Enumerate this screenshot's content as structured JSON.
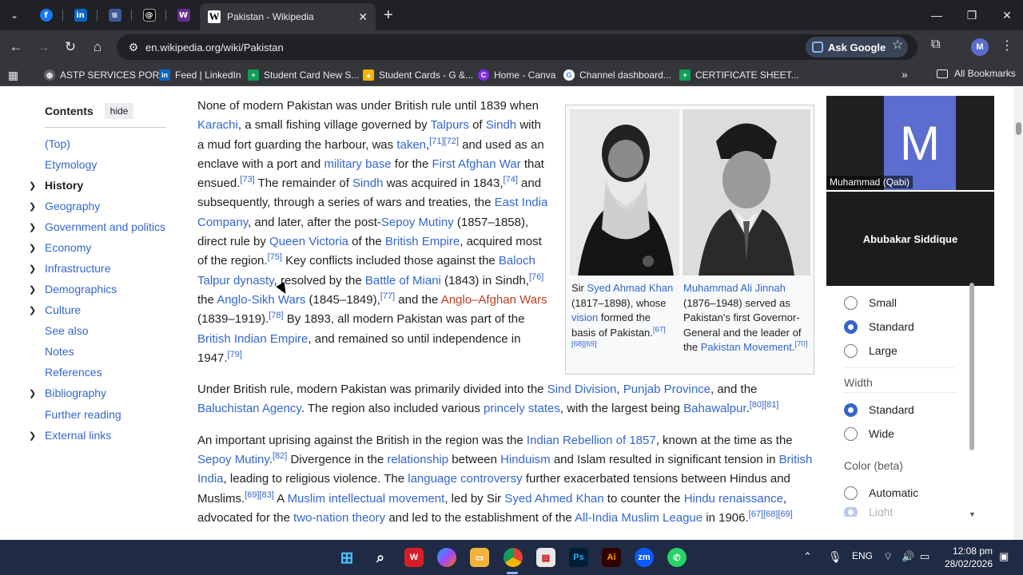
{
  "browser": {
    "active_tab_title": "Pakistan - Wikipedia",
    "url": "en.wikipedia.org/wiki/Pakistan",
    "ask_google": "Ask Google",
    "profile_initial": "M",
    "bookmarks": [
      {
        "label": "ASTP SERVICES POR...",
        "color": "#5f6368",
        "icon": "globe-icon"
      },
      {
        "label": "Feed | LinkedIn",
        "color": "#0a66c2",
        "icon": "linkedin-icon"
      },
      {
        "label": "Student Card New S...",
        "color": "#0f9d58",
        "icon": "sheets-icon"
      },
      {
        "label": "Student Cards - G &...",
        "color": "#f4b400",
        "icon": "drive-icon"
      },
      {
        "label": "Home - Canva",
        "color": "#7d2ae8",
        "icon": "canva-icon"
      },
      {
        "label": "Channel dashboard...",
        "color": "#5f6368",
        "icon": "google-icon"
      },
      {
        "label": "CERTIFICATE SHEET...",
        "color": "#0f9d58",
        "icon": "sheets-icon"
      }
    ],
    "all_bookmarks": "All Bookmarks"
  },
  "toc": {
    "title": "Contents",
    "hide": "hide",
    "items": [
      {
        "label": "(Top)",
        "expandable": false,
        "bold": false
      },
      {
        "label": "Etymology",
        "expandable": false,
        "bold": false
      },
      {
        "label": "History",
        "expandable": true,
        "bold": true
      },
      {
        "label": "Geography",
        "expandable": true,
        "bold": false
      },
      {
        "label": "Government and politics",
        "expandable": true,
        "bold": false
      },
      {
        "label": "Economy",
        "expandable": true,
        "bold": false
      },
      {
        "label": "Infrastructure",
        "expandable": true,
        "bold": false
      },
      {
        "label": "Demographics",
        "expandable": true,
        "bold": false
      },
      {
        "label": "Culture",
        "expandable": true,
        "bold": false
      },
      {
        "label": "See also",
        "expandable": false,
        "bold": false
      },
      {
        "label": "Notes",
        "expandable": false,
        "bold": false
      },
      {
        "label": "References",
        "expandable": false,
        "bold": false
      },
      {
        "label": "Bibliography",
        "expandable": true,
        "bold": false
      },
      {
        "label": "Further reading",
        "expandable": false,
        "bold": false
      },
      {
        "label": "External links",
        "expandable": true,
        "bold": false
      }
    ]
  },
  "article": {
    "paragraphs": [
      [
        {
          "t": "None of modern Pakistan was under British rule until 1839 when "
        },
        {
          "t": "Karachi",
          "link": true
        },
        {
          "t": ", a small fishing village governed by "
        },
        {
          "t": "Talpurs",
          "link": true
        },
        {
          "t": " of "
        },
        {
          "t": "Sindh",
          "link": true
        },
        {
          "t": " with a mud fort guarding the harbour, was "
        },
        {
          "t": "taken",
          "link": true
        },
        {
          "t": ",",
          "sup_after": "[71][72]"
        },
        {
          "t": " and used as an enclave with a port and "
        },
        {
          "t": "military base",
          "link": true
        },
        {
          "t": " for the "
        },
        {
          "t": "First Afghan War",
          "link": true
        },
        {
          "t": " that ensued."
        },
        {
          "t": "",
          "sup_after": "[73]"
        },
        {
          "t": " The remainder of "
        },
        {
          "t": "Sindh",
          "link": true
        },
        {
          "t": " was acquired in 1843,"
        },
        {
          "t": "",
          "sup_after": "[74]"
        },
        {
          "t": " and subsequently, through a series of wars and treaties, the "
        },
        {
          "t": "East India Company",
          "link": true
        },
        {
          "t": ", and later, after the post-"
        },
        {
          "t": "Sepoy Mutiny",
          "link": true
        },
        {
          "t": " (1857–1858), direct rule by "
        },
        {
          "t": "Queen Victoria",
          "link": true
        },
        {
          "t": " of the "
        },
        {
          "t": "British Empire",
          "link": true
        },
        {
          "t": ", acquired most of the region."
        },
        {
          "t": "",
          "sup_after": "[75]"
        },
        {
          "t": " Key conflicts included those against the "
        },
        {
          "t": "Baloch Talpur dynasty",
          "link": true
        },
        {
          "t": ", resolved by the "
        },
        {
          "t": "Battle of Miani",
          "link": true
        },
        {
          "t": " (1843) in Sindh,"
        },
        {
          "t": "",
          "sup_after": "[76]"
        },
        {
          "t": " the "
        },
        {
          "t": "Anglo-Sikh Wars",
          "link": true
        },
        {
          "t": " (1845–1849),"
        },
        {
          "t": "",
          "sup_after": "[77]"
        },
        {
          "t": " and the "
        },
        {
          "t": "Anglo–Afghan Wars",
          "link": "red"
        },
        {
          "t": " (1839–1919)."
        },
        {
          "t": "",
          "sup_after": "[78]"
        },
        {
          "t": " By 1893, all modern Pakistan was part of the "
        },
        {
          "t": "British Indian Empire",
          "link": true
        },
        {
          "t": ", and remained so until independence in 1947."
        },
        {
          "t": "",
          "sup_after": "[79]"
        }
      ],
      [
        {
          "t": "Under British rule, modern Pakistan was primarily divided into the "
        },
        {
          "t": "Sind Division",
          "link": true
        },
        {
          "t": ", "
        },
        {
          "t": "Punjab Province",
          "link": true
        },
        {
          "t": ", and the "
        },
        {
          "t": "Baluchistan Agency",
          "link": true
        },
        {
          "t": ". The region also included various "
        },
        {
          "t": "princely states",
          "link": true
        },
        {
          "t": ", with the largest being "
        },
        {
          "t": "Bahawalpur",
          "link": true
        },
        {
          "t": ".",
          "sup_after": "[80][81]"
        }
      ],
      [
        {
          "t": "An important uprising against the British in the region was the "
        },
        {
          "t": "Indian Rebellion of 1857",
          "link": true
        },
        {
          "t": ", known at the time as the "
        },
        {
          "t": "Sepoy Mutiny",
          "link": true
        },
        {
          "t": ".",
          "sup_after": "[82]"
        },
        {
          "t": " Divergence in the "
        },
        {
          "t": "relationship",
          "link": true
        },
        {
          "t": " between "
        },
        {
          "t": "Hinduism",
          "link": true
        },
        {
          "t": " and Islam resulted in significant tension in "
        },
        {
          "t": "British India",
          "link": true
        },
        {
          "t": ", leading to religious violence. The "
        },
        {
          "t": "language controversy",
          "link": true
        },
        {
          "t": " further exacerbated tensions between Hindus and Muslims."
        },
        {
          "t": "",
          "sup_after": "[69][83]"
        },
        {
          "t": " A "
        },
        {
          "t": "Muslim intellectual movement",
          "link": true
        },
        {
          "t": ", led by Sir "
        },
        {
          "t": "Syed Ahmed Khan",
          "link": true
        },
        {
          "t": " to counter the "
        },
        {
          "t": "Hindu renaissance",
          "link": true
        },
        {
          "t": ", advocated for the "
        },
        {
          "t": "two-nation theory",
          "link": true
        },
        {
          "t": " and led to the establishment of the "
        },
        {
          "t": "All-India Muslim League",
          "link": true
        },
        {
          "t": " in 1906."
        },
        {
          "t": "",
          "sup_after": "[67][68][69]"
        }
      ]
    ]
  },
  "figure": {
    "left_caption": [
      {
        "t": "Sir "
      },
      {
        "t": "Syed Ahmad Khan",
        "link": true
      },
      {
        "t": " (1817–1898), whose "
      },
      {
        "t": "vision",
        "link": true
      },
      {
        "t": " formed the basis of Pakistan."
      },
      {
        "t": "",
        "sup_after": "[67][68][69]"
      }
    ],
    "right_caption": [
      {
        "t": "Muhammad Ali Jinnah",
        "link": true
      },
      {
        "t": " (1876–1948) served as Pakistan's first Governor-General and the leader of the "
      },
      {
        "t": "Pakistan Movement",
        "link": true
      },
      {
        "t": ".",
        "sup_after": "[70]"
      }
    ]
  },
  "video": {
    "tile_initial": "M",
    "participant1": "Muhammad (Qabi)",
    "participant2": "Abubakar Siddique"
  },
  "appearance": {
    "text_options": [
      "Small",
      "Standard",
      "Large"
    ],
    "text_selected": "Standard",
    "width_label": "Width",
    "width_options": [
      "Standard",
      "Wide"
    ],
    "width_selected": "Standard",
    "color_label": "Color (beta)",
    "color_options": [
      "Automatic",
      "Light"
    ]
  },
  "taskbar": {
    "language": "ENG",
    "time": "12:08 pm",
    "date": "28/02/2026"
  }
}
